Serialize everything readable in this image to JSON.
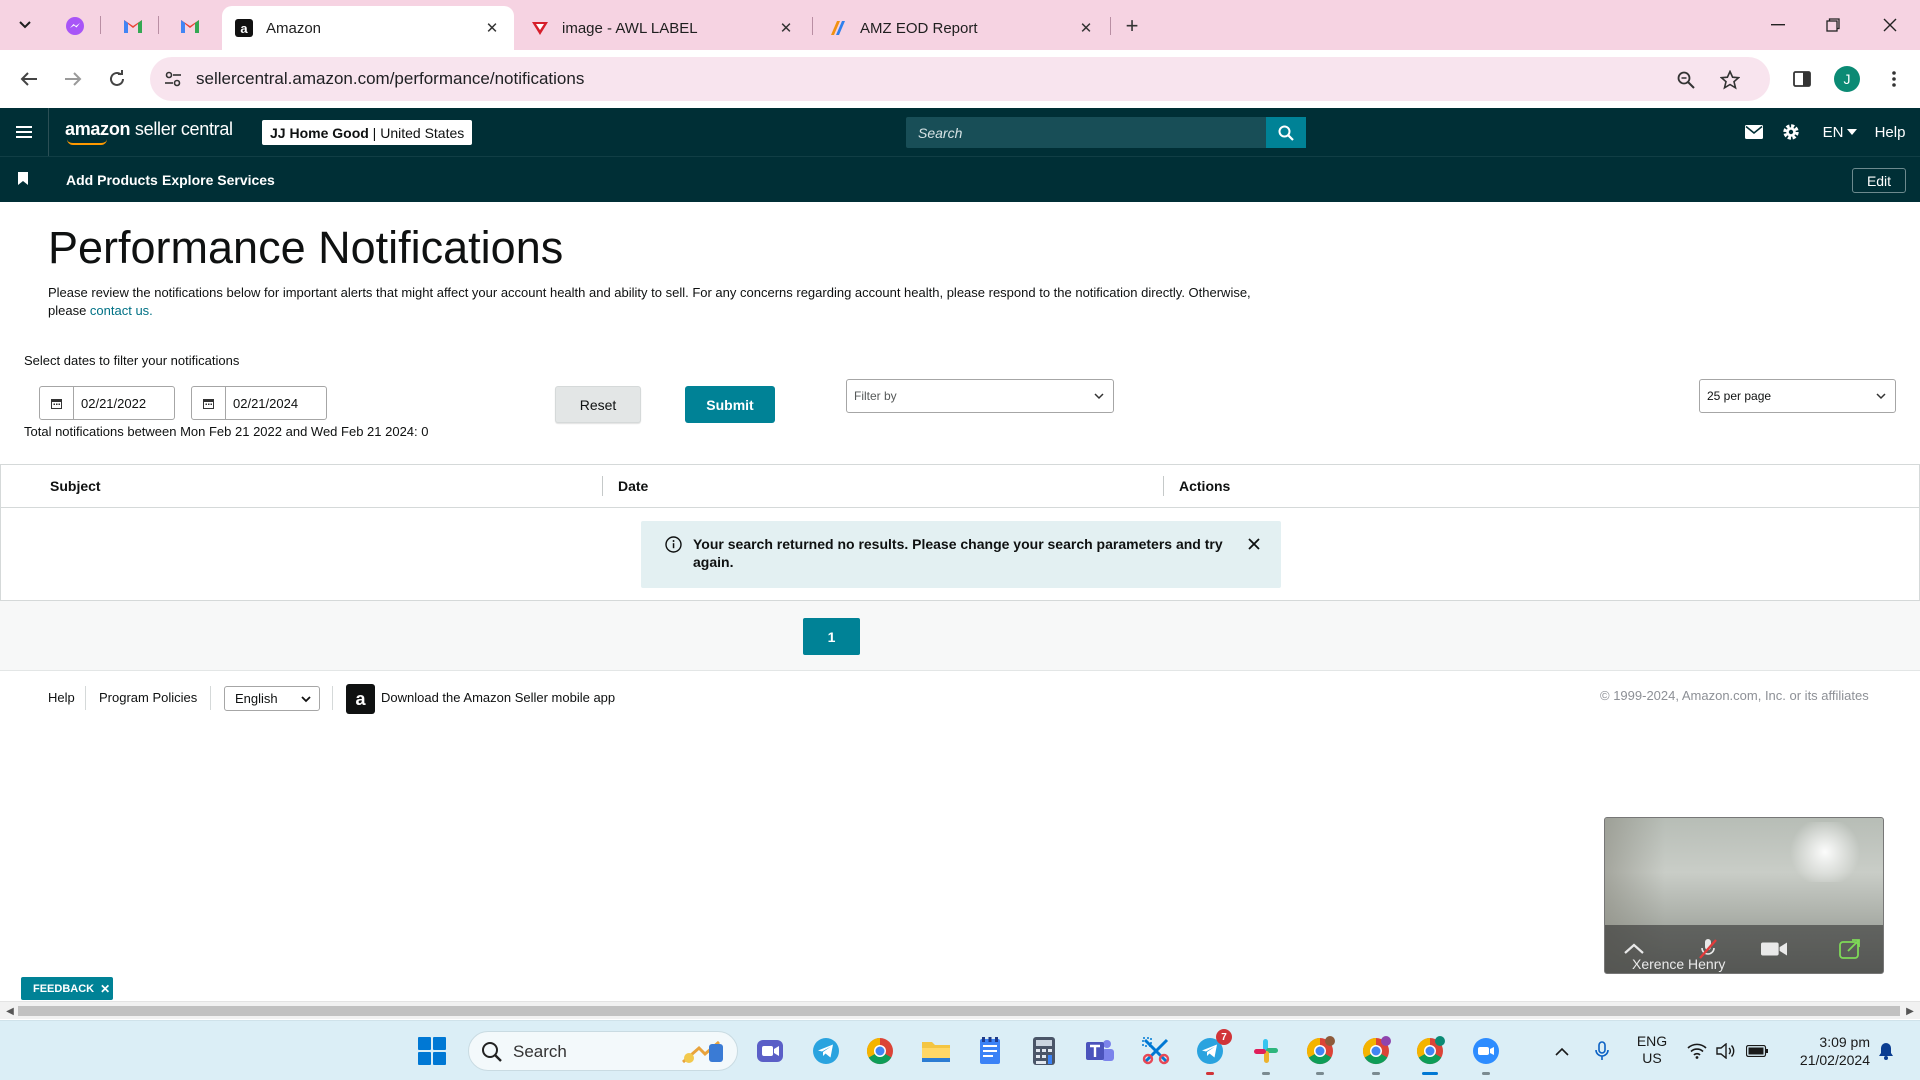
{
  "browser": {
    "tabs": [
      {
        "title": "Amazon",
        "active": true
      },
      {
        "title": "image - AWL LABEL",
        "active": false
      },
      {
        "title": "AMZ EOD Report",
        "active": false
      }
    ],
    "url": "sellercentral.amazon.com/performance/notifications",
    "profile_initial": "J"
  },
  "header": {
    "logo_bold": "amazon",
    "logo_rest": " seller central",
    "store_name": "JJ Home Good",
    "separator": " | ",
    "marketplace": "United States",
    "search_placeholder": "Search",
    "language": "EN",
    "help": "Help"
  },
  "subnav": {
    "links": [
      "Add Products",
      "Explore Services"
    ],
    "edit": "Edit"
  },
  "page": {
    "title": "Performance Notifications",
    "intro": "Please review the notifications below for important alerts that might affect your account health and ability to sell. For any concerns regarding account health, please respond to the notification directly. Otherwise, please ",
    "contact_link": "contact us.",
    "filter_label": "Select dates to filter your notifications",
    "date_from": "02/21/2022",
    "date_to": "02/21/2024",
    "total_line": "Total notifications between Mon Feb 21 2022 and Wed Feb 21 2024: 0",
    "reset": "Reset",
    "submit": "Submit",
    "filter_by": "Filter by",
    "per_page": "25 per page"
  },
  "table": {
    "columns": [
      "Subject",
      "Date",
      "Actions"
    ],
    "empty_message": "Your search returned no results. Please change your search parameters and try again."
  },
  "pagination": {
    "current_page": "1"
  },
  "footer": {
    "help": "Help",
    "program_policies": "Program Policies",
    "language": "English",
    "app_link": "Download the Amazon Seller mobile app",
    "copyright": "© 1999-2024, Amazon.com, Inc. or its affiliates"
  },
  "video": {
    "participant": "Xerence Henry"
  },
  "feedback": {
    "label": "FEEDBACK"
  },
  "taskbar": {
    "search": "Search",
    "telegram_badge": "7",
    "lang_line1": "ENG",
    "lang_line2": "US",
    "time": "3:09 pm",
    "date": "21/02/2024"
  },
  "colors": {
    "header_bg": "#002f36",
    "accent": "#008296",
    "link": "#007185",
    "tabstrip": "#f6d3e2"
  }
}
